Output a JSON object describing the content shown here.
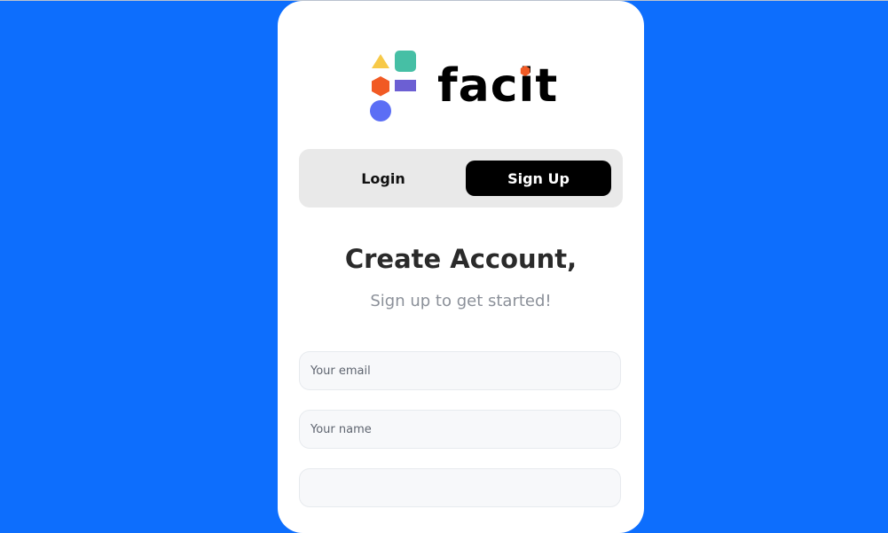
{
  "brand": {
    "name": "facit",
    "colors": {
      "triangle": "#f7c948",
      "square": "#46bfa5",
      "hexagon": "#f15a24",
      "bar": "#6c5fd3",
      "circle": "#5b6ef5",
      "dot": "#f15a24"
    }
  },
  "tabs": {
    "login_label": "Login",
    "signup_label": "Sign Up",
    "active": "Sign Up"
  },
  "heading": {
    "title": "Create Account,",
    "subtitle": "Sign up to get started!"
  },
  "form": {
    "email_placeholder": "Your email",
    "name_placeholder": "Your name",
    "password_placeholder": ""
  },
  "theme": {
    "background": "#0d6efd",
    "card": "#ffffff"
  }
}
